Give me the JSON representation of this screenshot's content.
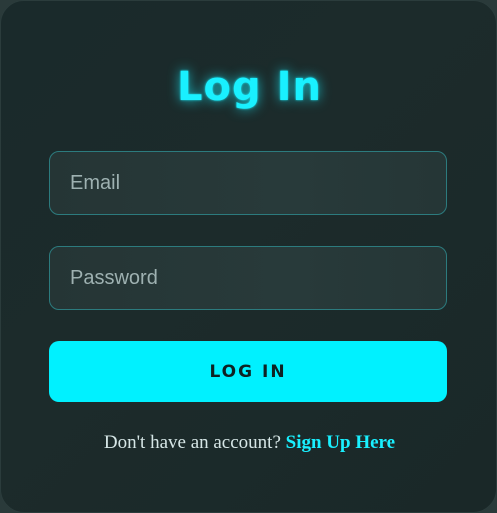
{
  "login_form": {
    "title": "Log In",
    "email": {
      "placeholder": "Email",
      "value": ""
    },
    "password": {
      "placeholder": "Password",
      "value": ""
    },
    "submit_label": "LOG IN",
    "signup_prompt": "Don't have an account? ",
    "signup_link_label": "Sign Up Here"
  },
  "colors": {
    "accent": "#00f1ff",
    "background": "#1c2b2b",
    "field_border": "#2c7b7e",
    "text": "#d6e6e6"
  }
}
